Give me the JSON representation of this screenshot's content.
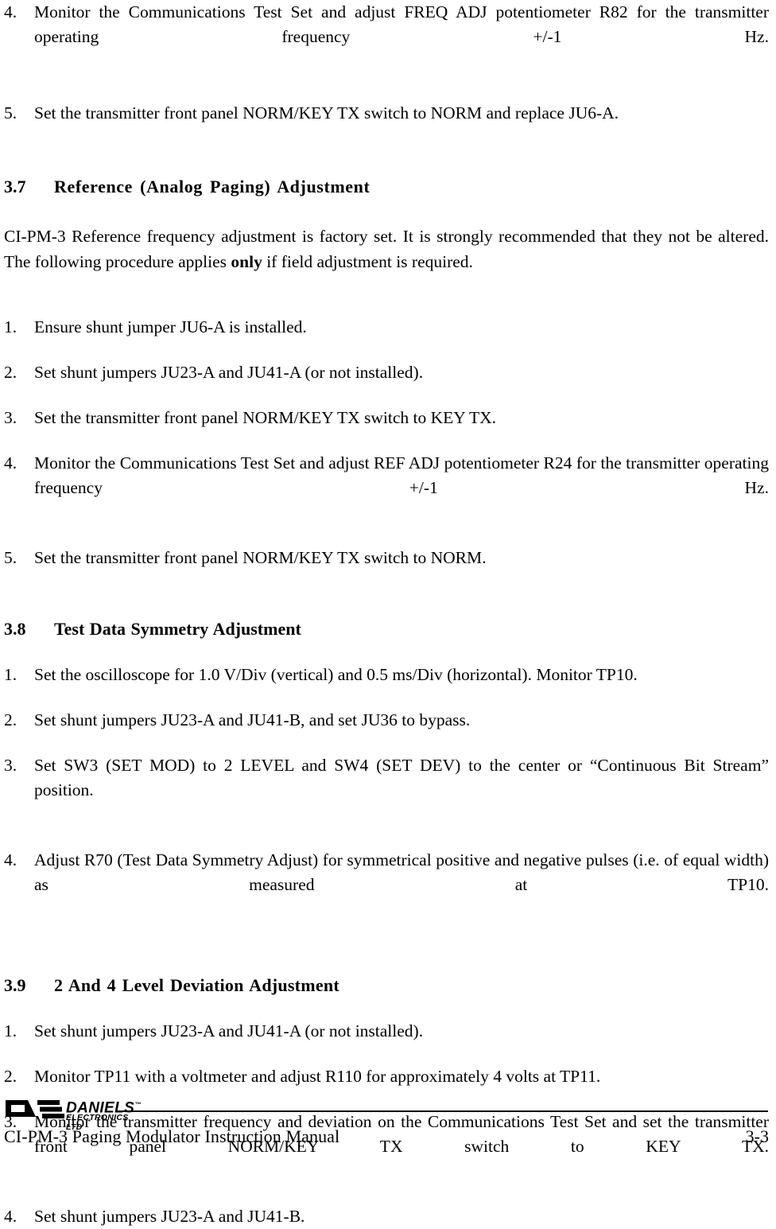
{
  "document": {
    "footer_title": "CI-PM-3 Paging Modulator Instruction Manual",
    "page_number": "3-3",
    "logo": {
      "brand": "DANIELS",
      "trademark": "™",
      "subtitle": "ELECTRONICS LTD"
    }
  },
  "top_continued_list": {
    "items": [
      {
        "marker": "4.",
        "text": "Monitor the Communications Test Set and adjust FREQ ADJ potentiometer R82 for the transmitter operating frequency +/-1 Hz."
      },
      {
        "marker": "5.",
        "text": "Set the transmitter front panel NORM/KEY TX switch to NORM and replace JU6-A."
      }
    ]
  },
  "sections": [
    {
      "id": "3.7",
      "number": "3.7",
      "title": "Reference (Analog Paging) Adjustment",
      "paragraph": {
        "before_bold": "CI-PM-3 Reference frequency adjustment is factory set.  It is strongly recommended that they not be altered. The following procedure applies ",
        "bold": "only",
        "after_bold": " if field adjustment is required."
      },
      "items": [
        {
          "marker": "1.",
          "text": "Ensure shunt jumper JU6-A is installed."
        },
        {
          "marker": "2.",
          "text": "Set shunt jumpers JU23-A and JU41-A (or not installed)."
        },
        {
          "marker": "3.",
          "text": "Set the transmitter front panel NORM/KEY TX switch to KEY TX."
        },
        {
          "marker": "4.",
          "text": "Monitor the Communications Test Set and adjust REF ADJ potentiometer R24 for the transmitter operating frequency +/-1 Hz."
        },
        {
          "marker": "5.",
          "text": "Set the transmitter front panel NORM/KEY TX switch to NORM."
        }
      ]
    },
    {
      "id": "3.8",
      "number": "3.8",
      "title": "Test Data Symmetry Adjustment",
      "items": [
        {
          "marker": "1.",
          "text": "Set the oscilloscope for 1.0 V/Div (vertical) and 0.5 ms/Div (horizontal). Monitor TP10."
        },
        {
          "marker": "2.",
          "text": "Set shunt jumpers JU23-A and JU41-B, and set JU36 to bypass."
        },
        {
          "marker": "3.",
          "text": "Set SW3 (SET MOD) to 2 LEVEL and SW4 (SET DEV) to the center or “Continuous Bit Stream” position."
        },
        {
          "marker": "4.",
          "text": "Adjust R70 (Test Data Symmetry Adjust) for symmetrical positive and negative pulses (i.e. of equal width) as measured at TP10."
        }
      ]
    },
    {
      "id": "3.9",
      "number": "3.9",
      "title": "2 And 4 Level Deviation Adjustment",
      "items": [
        {
          "marker": "1.",
          "text": "Set shunt jumpers JU23-A and JU41-A (or not installed)."
        },
        {
          "marker": "2.",
          "text": "Monitor TP11 with a voltmeter and adjust R110 for approximately 4 volts at TP11."
        },
        {
          "marker": "3.",
          "text": "Monitor the transmitter frequency and deviation on the Communications Test Set and set the transmitter front panel NORM/KEY TX switch to KEY TX."
        },
        {
          "marker": "4.",
          "text": "Set shunt jumpers JU23-A and JU41-B."
        }
      ]
    }
  ]
}
